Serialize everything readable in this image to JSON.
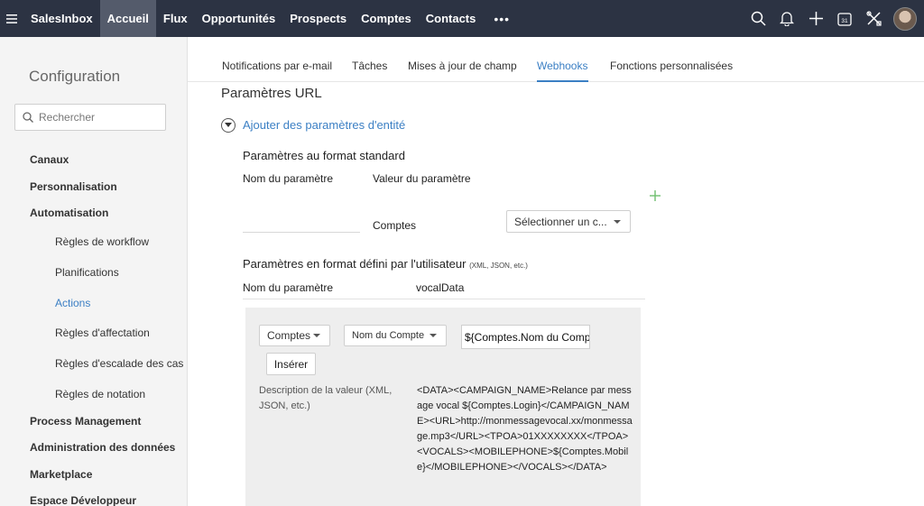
{
  "topbar": {
    "menu_icon": "hamburger-icon",
    "brand": "SalesInbox",
    "nav": [
      "Accueil",
      "Flux",
      "Opportunités",
      "Prospects",
      "Comptes",
      "Contacts"
    ],
    "active_nav": "Accueil",
    "more": "•••",
    "icons": [
      "search-icon",
      "bell-icon",
      "plus-icon",
      "calendar-icon",
      "tools-icon"
    ],
    "calendar_day": "31"
  },
  "sidebar": {
    "title": "Configuration",
    "search_placeholder": "Rechercher",
    "sections": [
      "Canaux",
      "Personnalisation",
      "Automatisation"
    ],
    "sub_items": [
      "Règles de workflow",
      "Planifications",
      "Actions",
      "Règles d'affectation",
      "Règles d'escalade des cas",
      "Règles de notation"
    ],
    "active_sub": "Actions",
    "bottom_sections": [
      "Process Management",
      "Administration des données",
      "Marketplace",
      "Espace Développeur"
    ]
  },
  "tabs": {
    "items": [
      "Notifications par e-mail",
      "Tâches",
      "Mises à jour de champ",
      "Webhooks",
      "Fonctions personnalisées"
    ],
    "active": "Webhooks"
  },
  "main": {
    "title": "Paramètres URL",
    "toggle_label": "Ajouter des paramètres d'entité",
    "standard_heading": "Paramètres au format standard",
    "col_name": "Nom du paramètre",
    "col_value": "Valeur du paramètre",
    "row_module": "Comptes",
    "row_select": "Sélectionner un c...",
    "custom_heading": "Paramètres en format défini par l'utilisateur",
    "custom_heading_small": "(XML, JSON, etc.)",
    "custom_name_label": "Nom du paramètre",
    "custom_name_value": "vocalData",
    "panel": {
      "module_select": "Comptes",
      "field_select": "Nom du Compte",
      "merge_field": "${Comptes.Nom du Compte}",
      "insert_button": "Insérer",
      "desc_label": "Description de la valeur (XML, JSON, etc.)",
      "desc_value": "<DATA><CAMPAIGN_NAME>Relance par message vocal ${Comptes.Login}</CAMPAIGN_NAME><URL>http://monmessagevocal.xx/monmessage.mp3</URL><TPOA>01XXXXXXXX</TPOA><VOCALS><MOBILEPHONE>${Comptes.Mobile}</MOBILEPHONE></VOCALS></DATA>"
    }
  },
  "colors": {
    "topbar_bg": "#2c3343",
    "accent": "#3b7fc4",
    "add_plus": "#6fbf6f"
  }
}
